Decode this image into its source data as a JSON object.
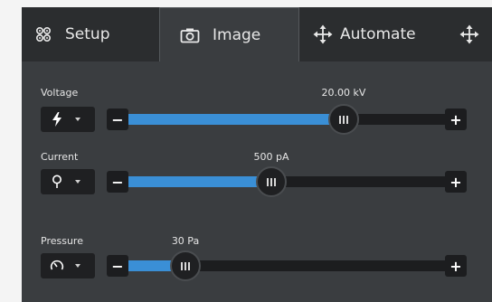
{
  "tabs": {
    "setup": {
      "label": "Setup",
      "icon": "gear-cluster-icon"
    },
    "image": {
      "label": "Image",
      "icon": "camera-icon",
      "active": true
    },
    "automate": {
      "label": "Automate",
      "icon": "move-arrows-icon"
    },
    "more": {
      "icon": "move-arrows-icon"
    }
  },
  "controls": {
    "voltage": {
      "label": "Voltage",
      "value_text": "20.00 kV",
      "icon": "lightning-bolt-icon",
      "level": 0.68
    },
    "current": {
      "label": "Current",
      "value_text": "500 pA",
      "icon": "lightbulb-icon",
      "level": 0.45
    },
    "pressure": {
      "label": "Pressure",
      "value_text": "30 Pa",
      "icon": "gauge-icon",
      "level": 0.18
    }
  },
  "buttons": {
    "minus": "−",
    "plus": "+"
  },
  "colors": {
    "accent": "#3a8fd6",
    "panel": "#3a3d40",
    "tabbar": "#2b2d2f"
  }
}
